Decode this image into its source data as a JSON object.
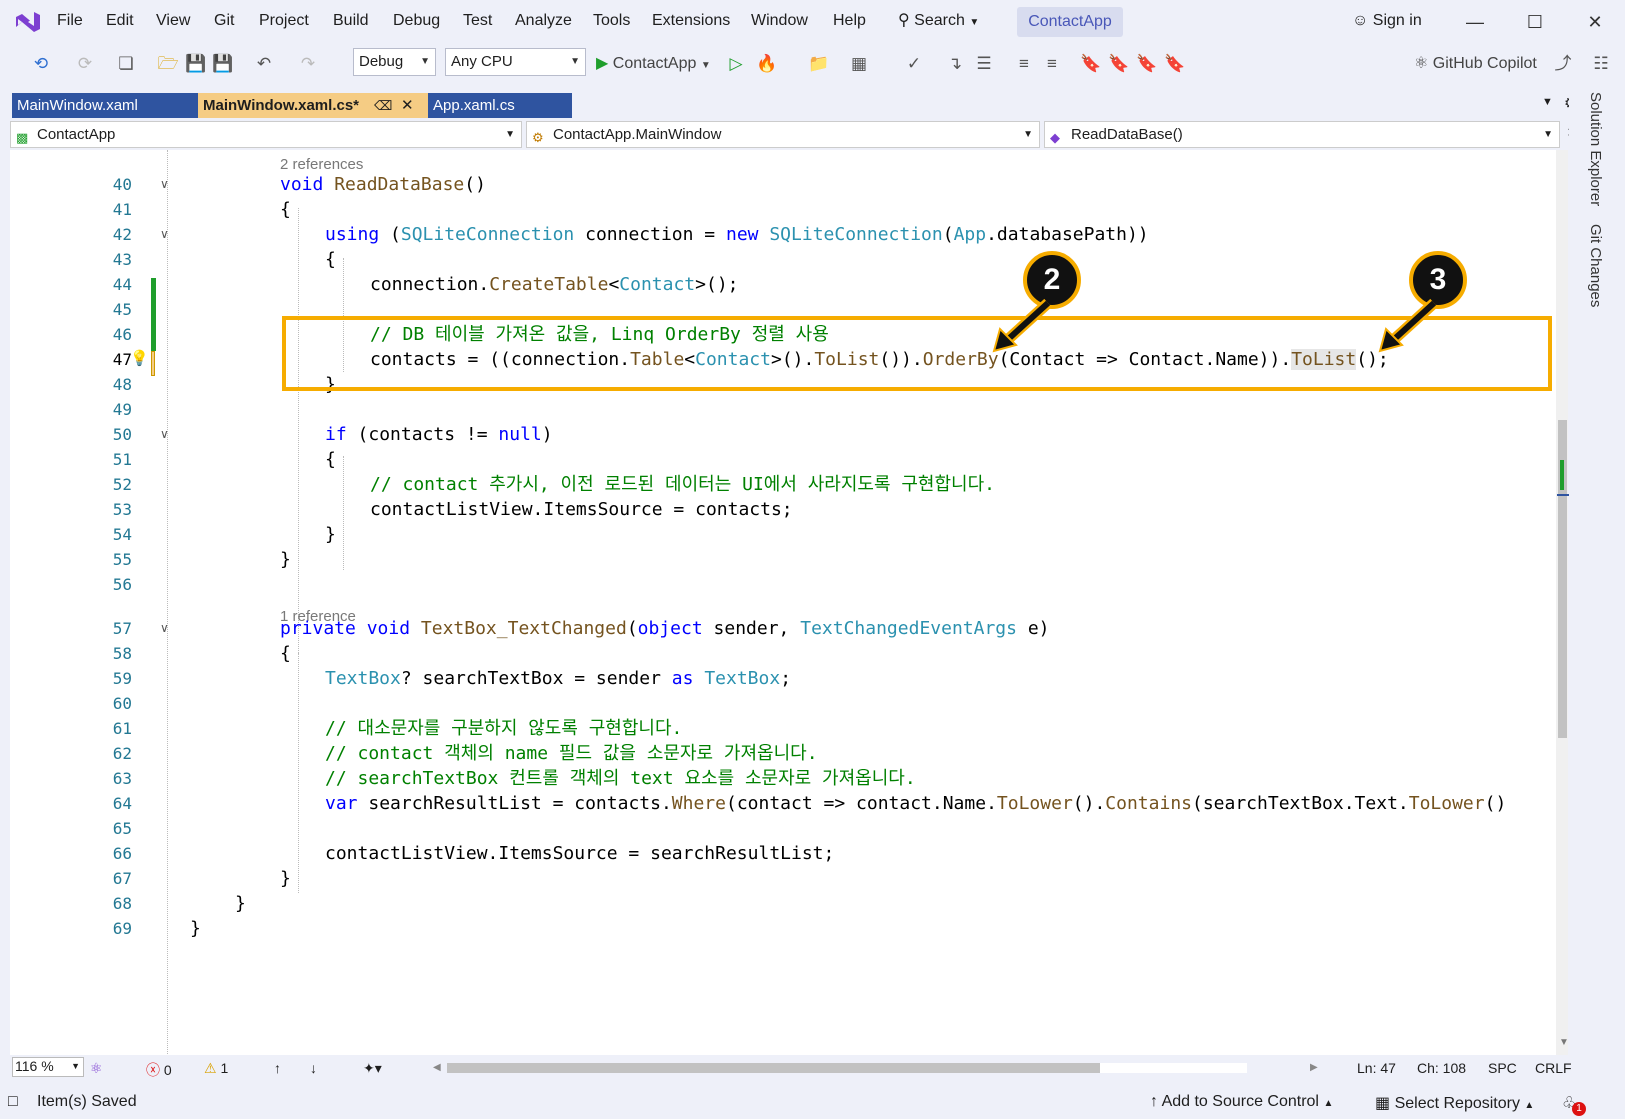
{
  "menu": [
    "File",
    "Edit",
    "View",
    "Git",
    "Project",
    "Build",
    "Debug",
    "Test",
    "Analyze",
    "Tools",
    "Extensions",
    "Window",
    "Help"
  ],
  "search_label": "Search",
  "app_name": "ContactApp",
  "sign_in": "Sign in",
  "toolbar": {
    "config": "Debug",
    "platform": "Any CPU",
    "run_target": "ContactApp",
    "copilot": "GitHub Copilot"
  },
  "tabs": [
    {
      "label": "MainWindow.xaml"
    },
    {
      "label": "MainWindow.xaml.cs*"
    },
    {
      "label": "App.xaml.cs"
    }
  ],
  "nav": {
    "project": "ContactApp",
    "class": "ContactApp.MainWindow",
    "member": "ReadDataBase()"
  },
  "rail": [
    "Solution Explorer",
    "Git Changes"
  ],
  "code": {
    "refs_a": "2 references",
    "refs_b": "1 reference",
    "line_numbers": [
      "40",
      "41",
      "42",
      "43",
      "44",
      "45",
      "46",
      "47",
      "48",
      "49",
      "50",
      "51",
      "52",
      "53",
      "54",
      "55",
      "56",
      "57",
      "58",
      "59",
      "60",
      "61",
      "62",
      "63",
      "64",
      "65",
      "66",
      "67",
      "68",
      "69"
    ],
    "comment_46": "// DB 테이블 가져온 값을, Linq OrderBy 정렬 사용",
    "comment_51": "// contact 추가시, 이전 로드된 데이터는 UI에서 사라지도록 구현합니다.",
    "comment_61": "// 대소문자를 구분하지 않도록 구현합니다.",
    "comment_62": "// contact 객체의 name 필드 값을 소문자로 가져옵니다.",
    "comment_63": "// searchTextBox 컨트롤 객체의 text 요소를 소문자로 가져옵니다."
  },
  "callouts": [
    "2",
    "3"
  ],
  "editor_status": {
    "zoom": "116 %",
    "errors": "0",
    "warnings": "1",
    "ln": "Ln: 47",
    "ch": "Ch: 108",
    "spc": "SPC",
    "crlf": "CRLF"
  },
  "status": {
    "message": "Item(s) Saved",
    "source_control": "Add to Source Control",
    "repo": "Select Repository",
    "notifications": "1"
  },
  "colors": {
    "accent": "#f6ac00",
    "tab_active": "#f5cc84",
    "tab_inactive": "#2f54a0"
  }
}
